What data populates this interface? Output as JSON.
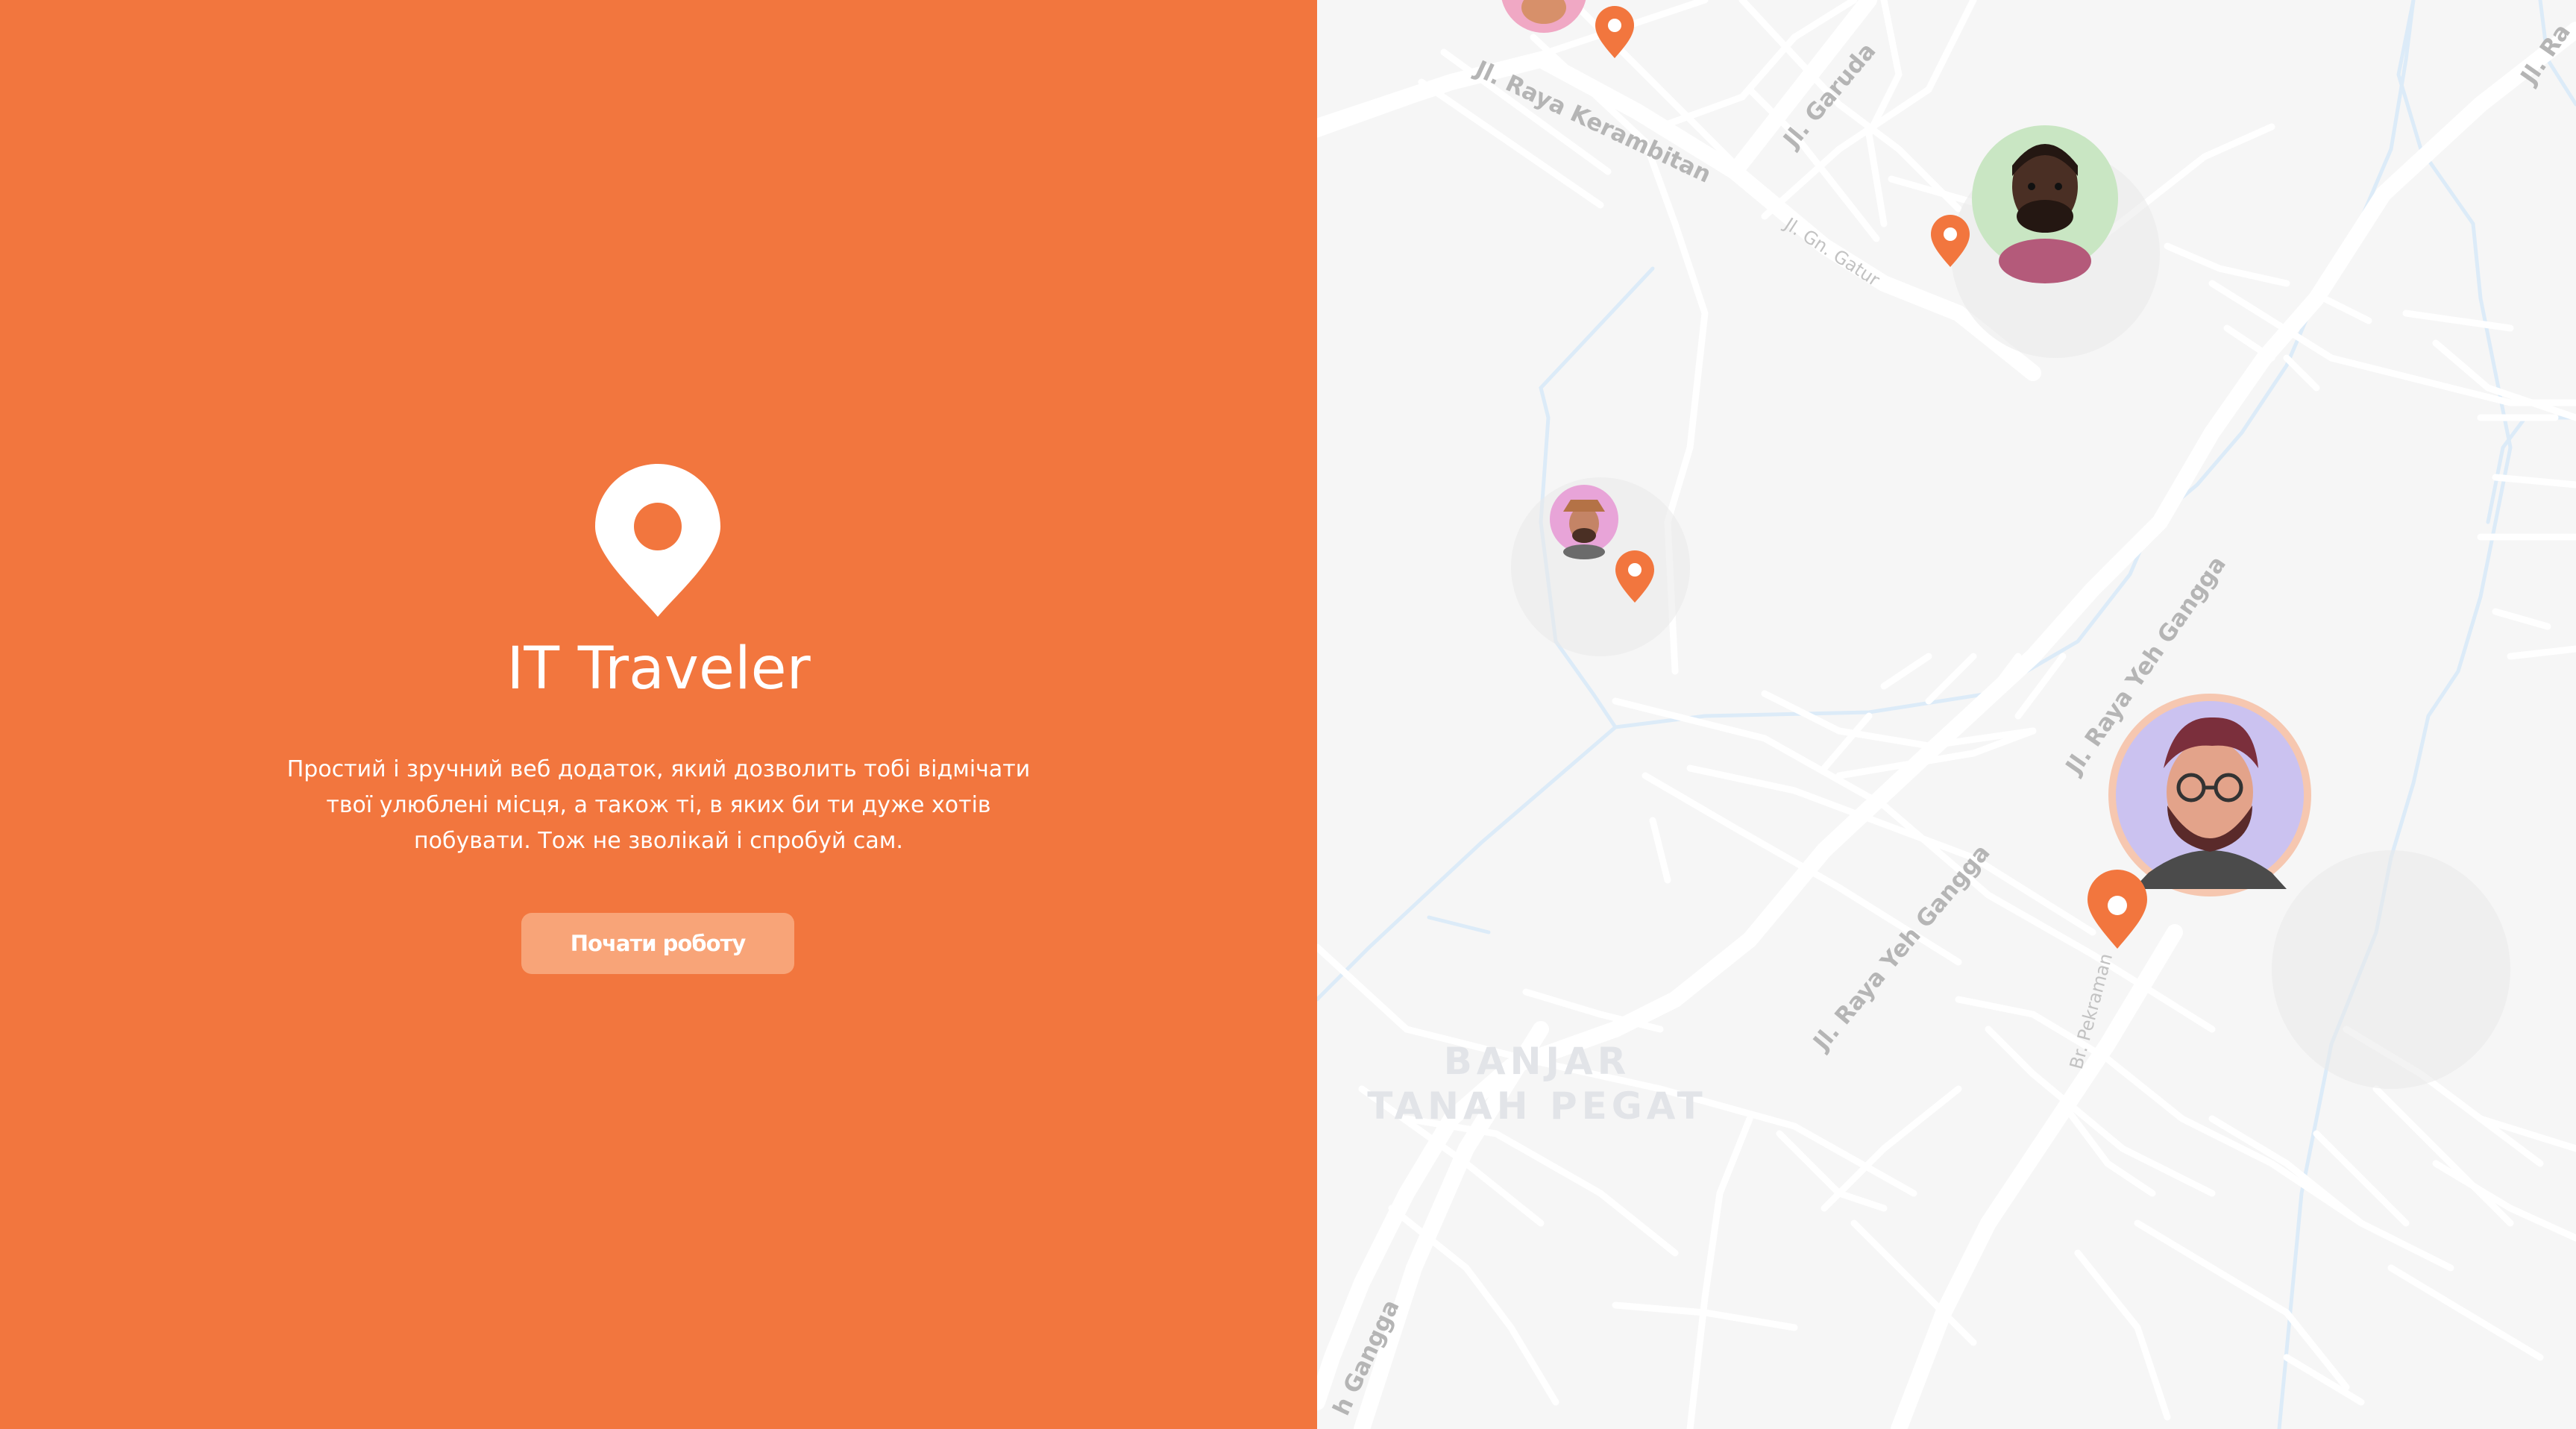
{
  "app": {
    "title": "IT Traveler",
    "description": "Простий і зручний веб додаток, який дозволить тобі відмічати твої улюблені місця, а також ті, в яких би ти дуже хотів побувати. Тож не зволікай і спробуй сам.",
    "start_button_label": "Почати роботу"
  },
  "colors": {
    "brand": "#F2763E",
    "button": "#F8A478",
    "map_background": "#F6F6F6",
    "road": "#FFFFFF",
    "water": "#DCEBF8"
  },
  "icons": [
    "map-pin-icon"
  ],
  "map": {
    "streets": [
      "Jl. Raya Kerambitan",
      "Jl. Garuda",
      "Jl. Gn. Gatur",
      "Jl. Raya Yeh Gangga",
      "Jl. Raya Yeh Gangga",
      "Br. Pekraman",
      "Jl. Ra",
      "h Gangga"
    ],
    "area_label_line1": "BANJAR",
    "area_label_line2": "TANAH PEGAT",
    "markers": [
      {
        "avatar_bg": "#F0A8C4"
      },
      {
        "avatar_bg": "#C9E6C3"
      },
      {
        "avatar_bg": "#E8A4D8"
      },
      {
        "avatar_bg": "#CBC2F0"
      }
    ]
  }
}
